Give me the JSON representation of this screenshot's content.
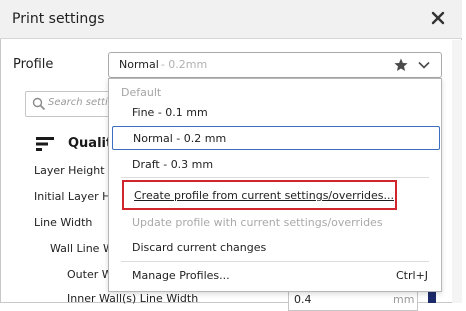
{
  "window": {
    "title": "Print settings"
  },
  "profile": {
    "label": "Profile",
    "selected_name": "Normal",
    "selected_sub": "- 0.2mm"
  },
  "search": {
    "placeholder": "Search settings"
  },
  "category": {
    "label": "Quality"
  },
  "settings": [
    {
      "label": "Layer Height"
    },
    {
      "label": "Initial Layer Height"
    },
    {
      "label": "Line Width"
    },
    {
      "label": "Wall Line Width"
    },
    {
      "label": "Outer Wall Line Width"
    },
    {
      "label": "Inner Wall(s) Line Width",
      "value": "0.4",
      "unit": "mm"
    }
  ],
  "dropdown": {
    "section_header": "Default",
    "profiles": [
      {
        "label": "Fine - 0.1 mm"
      },
      {
        "label": "Normal - 0.2 mm"
      },
      {
        "label": "Draft - 0.3 mm"
      }
    ],
    "actions": {
      "create": "Create profile from current settings/overrides...",
      "update": "Update profile with current settings/overrides",
      "discard": "Discard current changes",
      "manage": "Manage Profiles...",
      "manage_shortcut": "Ctrl+J"
    }
  },
  "colors": {
    "highlight": "#d0252c",
    "selection": "#3a6cc0",
    "accent_bar": "#1b2a6b"
  },
  "icons": [
    "close-icon",
    "star-icon",
    "chevron-down-icon",
    "search-icon",
    "category-icon"
  ]
}
